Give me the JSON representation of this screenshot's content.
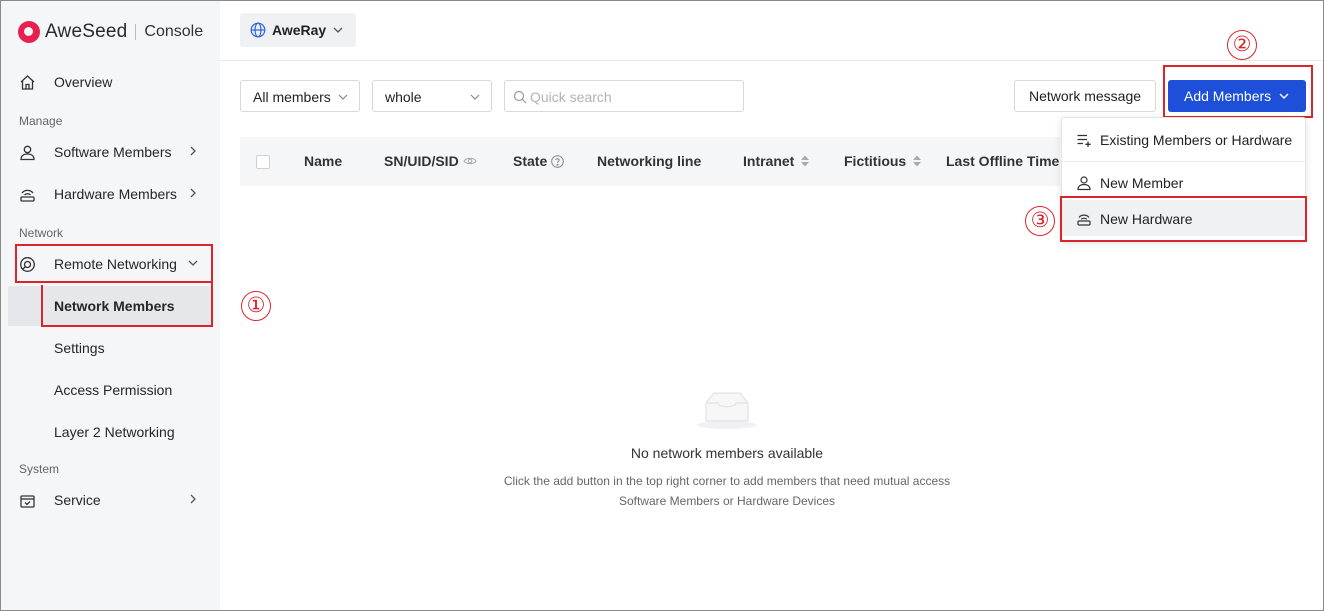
{
  "brand": {
    "name": "AweSeed",
    "console": "Console"
  },
  "sidebar": {
    "overview": "Overview",
    "section_manage": "Manage",
    "software_members": "Software Members",
    "hardware_members": "Hardware Members",
    "section_network": "Network",
    "remote_networking": "Remote Networking",
    "sub_items": [
      "Network Members",
      "Settings",
      "Access Permission",
      "Layer 2 Networking"
    ],
    "section_system": "System",
    "service": "Service"
  },
  "header": {
    "network_name": "AweRay"
  },
  "toolbar": {
    "member_filter": "All members",
    "state_filter": "whole",
    "search_placeholder": "Quick search",
    "network_message": "Network message",
    "add_members": "Add Members"
  },
  "table": {
    "columns": [
      "Name",
      "SN/UID/SID",
      "State",
      "Networking line",
      "Intranet",
      "Fictitious",
      "Last Offline Time"
    ]
  },
  "dropdown": {
    "items": [
      "Existing Members or Hardware",
      "New Member",
      "New Hardware"
    ]
  },
  "empty_state": {
    "title": "No network members available",
    "desc_line1": "Click the add button in the top right corner to add members that need mutual access",
    "desc_line2": "Software Members or Hardware Devices"
  },
  "annotations": [
    "①",
    "②",
    "③"
  ],
  "colors": {
    "primary": "#1d4fd8",
    "annotation_red": "#d9252b",
    "brand": "#e8204f"
  }
}
